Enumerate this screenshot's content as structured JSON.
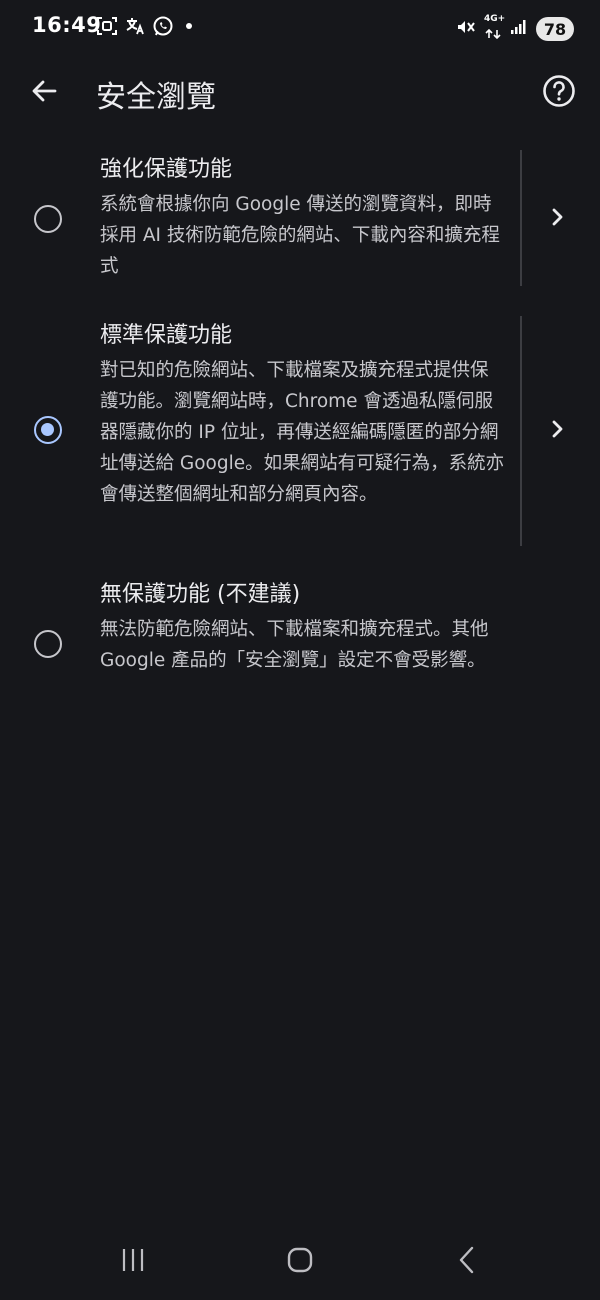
{
  "status_bar": {
    "time": "16:49",
    "network": "4G+",
    "battery": "78"
  },
  "app_bar": {
    "title": "安全瀏覽"
  },
  "options": [
    {
      "title": "強化保護功能",
      "description": "系統會根據你向 Google 傳送的瀏覽資料，即時採用 AI 技術防範危險的網站、下載內容和擴充程式",
      "selected": false
    },
    {
      "title": "標準保護功能",
      "description": "對已知的危險網站、下載檔案及擴充程式提供保護功能。瀏覽網站時，Chrome 會透過私隱伺服器隱藏你的 IP 位址，再傳送經編碼隱匿的部分網址傳送給 Google。如果網站有可疑行為，系統亦會傳送整個網址和部分網頁內容。",
      "selected": true
    },
    {
      "title": "無保護功能 (不建議)",
      "description": "無法防範危險網站、下載檔案和擴充程式。其他 Google 產品的「安全瀏覽」設定不會受影響。",
      "selected": false
    }
  ],
  "colors": {
    "background": "#16171b",
    "accent": "#a9c7ff"
  }
}
